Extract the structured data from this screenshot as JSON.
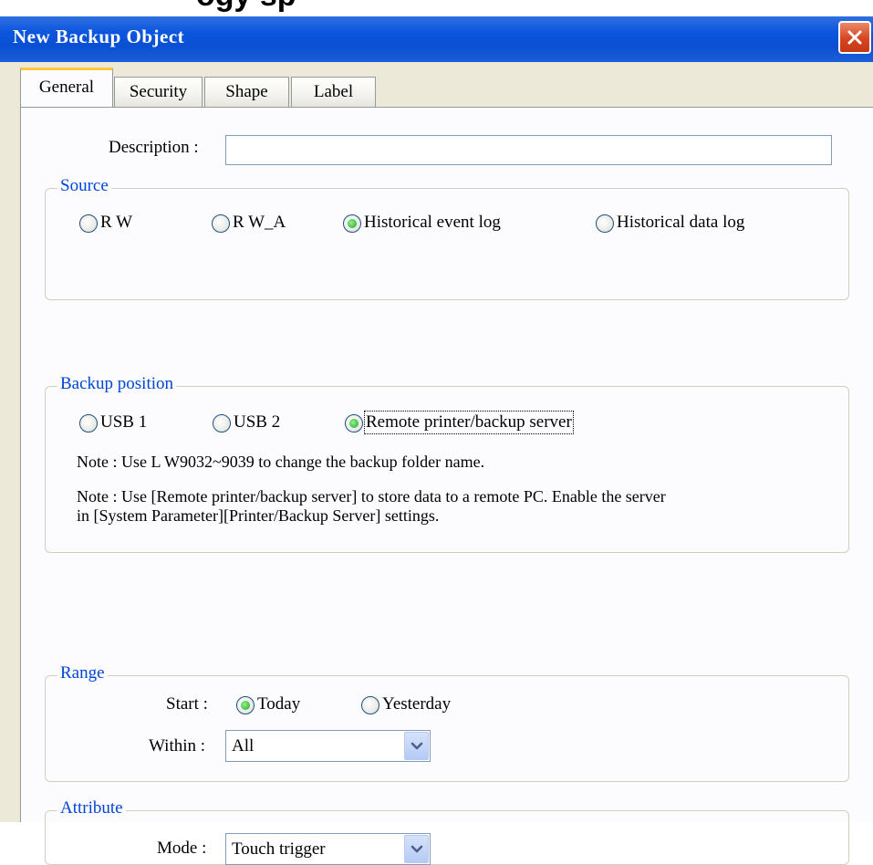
{
  "window": {
    "title": "New  Backup Object",
    "top_fragment": "ogy  sp"
  },
  "tabs": [
    {
      "label": "General",
      "active": true
    },
    {
      "label": "Security",
      "active": false
    },
    {
      "label": "Shape",
      "active": false
    },
    {
      "label": "Label",
      "active": false
    }
  ],
  "general": {
    "description_label": "Description :",
    "description_value": ""
  },
  "source": {
    "legend": "Source",
    "options": [
      {
        "label": "R W",
        "selected": false
      },
      {
        "label": "R W_A",
        "selected": false
      },
      {
        "label": "Historical event log",
        "selected": true
      },
      {
        "label": "Historical data log",
        "selected": false
      }
    ]
  },
  "backup_position": {
    "legend": "Backup position",
    "options": [
      {
        "label": "USB 1",
        "selected": false
      },
      {
        "label": "USB 2",
        "selected": false
      },
      {
        "label": "Remote printer/backup server",
        "selected": true
      }
    ],
    "note1": "Note : Use L W9032~9039 to change the backup folder name.",
    "note2_line1": "Note : Use [Remote printer/backup server] to store data to a remote PC. Enable the server",
    "note2_line2": "in [System Parameter][Printer/Backup Server] settings."
  },
  "range": {
    "legend": "Range",
    "start_label": "Start :",
    "start_options": [
      {
        "label": "Today",
        "selected": true
      },
      {
        "label": "Yesterday",
        "selected": false
      }
    ],
    "within_label": "Within :",
    "within_value": "All"
  },
  "attribute": {
    "legend": "Attribute",
    "mode_label": "Mode :",
    "mode_value": "Touch trigger"
  },
  "colors": {
    "titlebar": "#0a4fd3",
    "dialog_bg": "#ece9d8",
    "group_legend": "#0046d5",
    "close_button": "#d6451f",
    "tab_highlight": "#ffc83c"
  }
}
